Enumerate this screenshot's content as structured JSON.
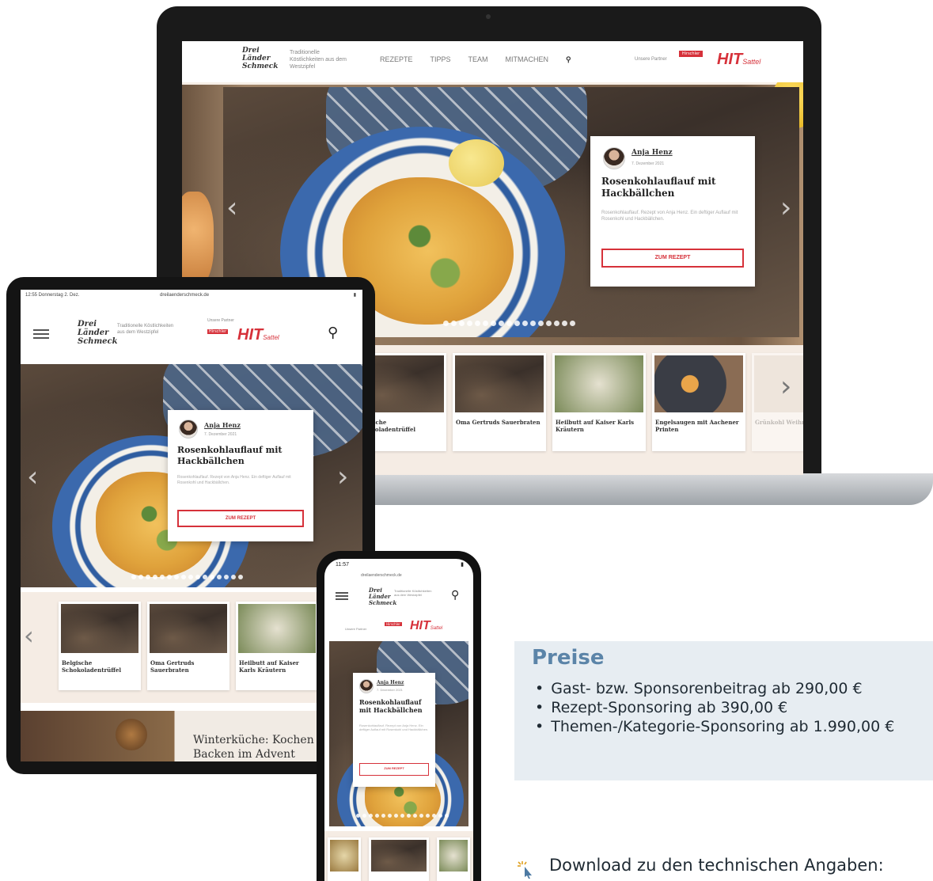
{
  "brand": {
    "logo_line1": "Drei",
    "logo_line2": "Länder",
    "logo_line3": "Schmeck",
    "tagline": "Traditionelle Köstlichkeiten aus dem Westzipfel",
    "partner_label": "Unsere Partner",
    "partner1": "Hirschler",
    "partner2": "HIT",
    "partner2_sub": "Sattel"
  },
  "laptop": {
    "nav": [
      "REZEPTE",
      "TIPPS",
      "TEAM",
      "MITMACHEN"
    ]
  },
  "tablet": {
    "status_left": "12:55 Donnerstag 2. Dez.",
    "url": "dreilaenderschmeck.de",
    "feature_title": "Winterküche: Kochen und Backen im Advent"
  },
  "phone": {
    "time": "11:57",
    "url": "dreilaenderschmeck.de"
  },
  "recipe": {
    "author": "Anja Henz",
    "date": "7. Dezember 2021",
    "title": "Rosenkohlauflauf mit Hackbällchen",
    "excerpt": "Rosenkohlauflauf. Rezept von Anja Henz. Ein deftiger Auflauf mit Rosenkohl und Hackbällchen.",
    "button": "ZUM REZEPT"
  },
  "thumbs": [
    {
      "label": "Belgische Schokoladentrüffel"
    },
    {
      "label": "Oma Gertruds Sauerbraten"
    },
    {
      "label": "Heilbutt auf Kaiser Karls Kräutern"
    },
    {
      "label": "Engelsaugen mit Aachener Printen"
    },
    {
      "label": "Grünkohl Weihnacht"
    }
  ],
  "prices": {
    "title": "Preise",
    "items": [
      "Gast- bzw. Sponsorenbeitrag ab 290,00 €",
      "Rezept-Sponsoring ab 390,00 €",
      "Themen-/Kategorie-Sponsoring ab 1.990,00 €"
    ]
  },
  "download": {
    "icon": "click-cursor-icon",
    "label": "Download zu den technischen Angaben:"
  },
  "colors": {
    "accent": "#d6313a",
    "price_title": "#5b84a8",
    "price_bg": "#e7edf2"
  }
}
